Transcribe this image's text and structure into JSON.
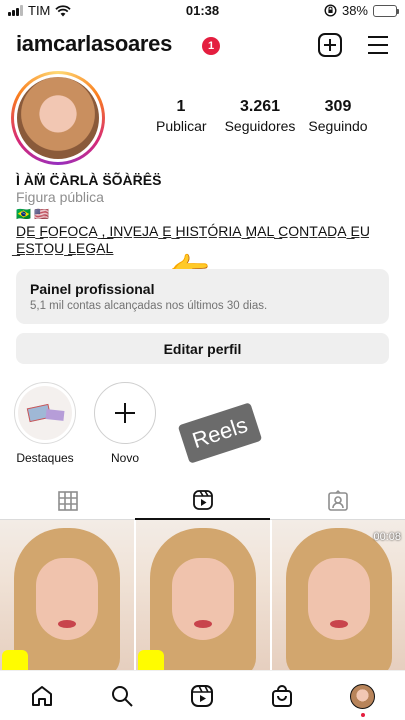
{
  "status_bar": {
    "carrier": "TIM",
    "time": "01:38",
    "battery": "38%",
    "battery_level": 0.38,
    "icons": [
      "signal-icon",
      "wifi-icon",
      "orientation-lock-icon",
      "battery-charging-icon"
    ]
  },
  "header": {
    "username": "iamcarlasoares",
    "notification_count": "1",
    "icons": [
      "new-post-icon",
      "menu-icon"
    ]
  },
  "profile": {
    "stats": [
      {
        "value": "1",
        "label": "Publicar"
      },
      {
        "value": "3.261",
        "label": "Seguidores"
      },
      {
        "value": "309",
        "label": "Seguindo"
      }
    ],
    "display_name": "Ì ÀM̈ C̈ÀRLÀ S̈ÕÀR̈ÊS̈",
    "category": "Figura pública",
    "flags": "🇧🇷 🇺🇸",
    "bio": "D̲E̲ ̲F̲O̲F̲O̲C̲A̲ ̲,̲ ̲I̲N̲V̲E̲J̲A̲ ̲E̲ ̲H̲I̲S̲T̲Ó̲R̲I̲A̲ ̲M̲A̲L̲ ̲C̲O̲N̲T̲A̲D̲A̲ ̲E̲U̲ ̲E̲S̲T̲O̲U̲ ̲L̲E̲G̲A̲L̲",
    "pointer_emoji": "👉"
  },
  "dashboard": {
    "title": "Painel profissional",
    "subtitle": "5,1 mil contas alcançadas nos últimos 30 dias."
  },
  "edit_profile_label": "Editar perfil",
  "highlights": [
    {
      "label": "Destaques"
    },
    {
      "label": "Novo",
      "icon": "plus-icon"
    }
  ],
  "sticker_text": "Reels",
  "tabs": [
    {
      "icon": "grid-icon",
      "active": false
    },
    {
      "icon": "reels-icon",
      "active": true
    },
    {
      "icon": "tagged-icon",
      "active": false
    }
  ],
  "grid": {
    "video_duration": "00:08"
  },
  "bottom_nav": {
    "items": [
      "home-icon",
      "search-icon",
      "reels-icon",
      "shop-icon",
      "profile-avatar"
    ],
    "accent_color": "#e41e3f"
  }
}
